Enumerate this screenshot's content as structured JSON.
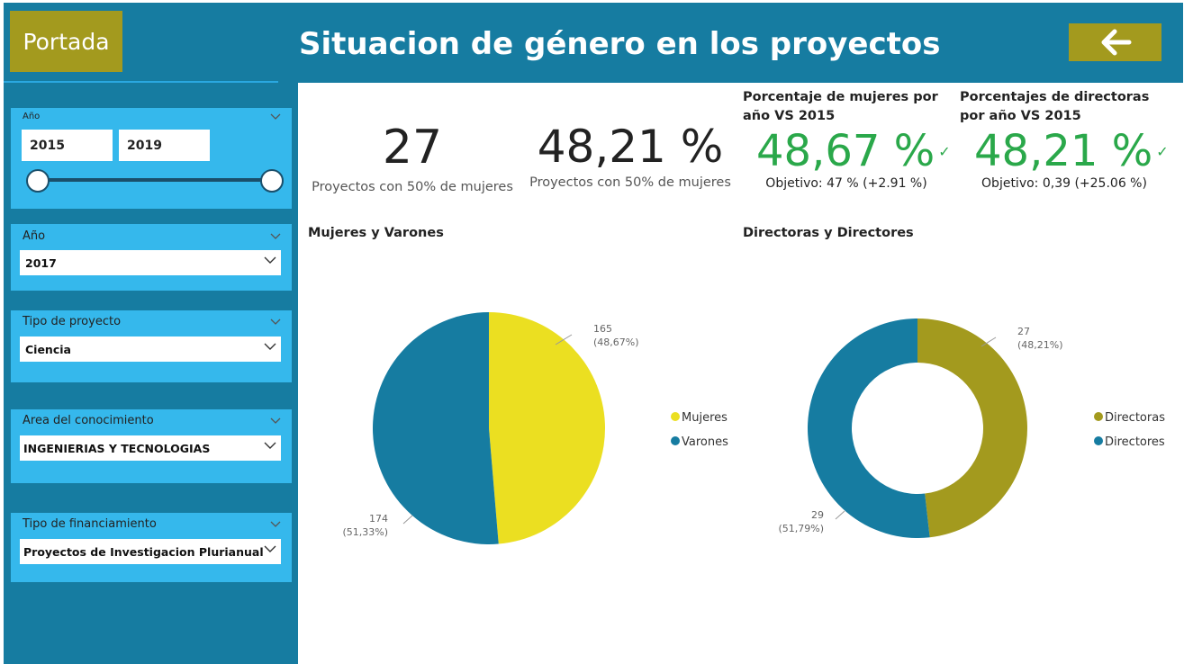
{
  "header": {
    "home_label": "Portada",
    "title": "Situacion de género en los proyectos",
    "back_icon": "arrow-left-icon"
  },
  "colors": {
    "teal": "#167ca1",
    "slicer_bg": "#35b8ec",
    "olive": "#a39a1e",
    "yellow": "#ebdf21",
    "green": "#2aa84a"
  },
  "filters": {
    "range": {
      "label": "Año",
      "start": "2015",
      "end": "2019"
    },
    "year": {
      "label": "Año",
      "value": "2017"
    },
    "project_type": {
      "label": "Tipo de proyecto",
      "value": "Ciencia"
    },
    "knowledge_area": {
      "label": "Area del conocimiento",
      "value": "INGENIERIAS Y TECNOLOGIAS"
    },
    "funding_type": {
      "label": "Tipo de financiamiento",
      "value": "Proyectos de Investigacion Plurianual"
    }
  },
  "kpis": [
    {
      "value": "27",
      "label": "Proyectos con 50% de mujeres"
    },
    {
      "value": "48,21 %",
      "label": "Proyectos con 50% de mujeres"
    }
  ],
  "cards": [
    {
      "title": "Porcentaje de mujeres por año VS 2015",
      "value": "48,67 %",
      "goal": "Objetivo: 47 % (+2.91 %)",
      "status_icon": "checkmark-icon"
    },
    {
      "title": "Porcentajes de directoras por año VS 2015",
      "value": "48,21 %",
      "goal": "Objetivo: 0,39 (+25.06 %)",
      "status_icon": "checkmark-icon"
    }
  ],
  "chart_data": [
    {
      "type": "pie",
      "title": "Mujeres y Varones",
      "categories": [
        "Mujeres",
        "Varones"
      ],
      "values": [
        165,
        174
      ],
      "data_labels": [
        "165",
        "174"
      ],
      "pct_labels": [
        "(48,67%)",
        "(51,33%)"
      ],
      "colors": [
        "#ebdf21",
        "#167ca1"
      ],
      "legend": "right"
    },
    {
      "type": "pie",
      "variant": "donut",
      "title": "Directoras y Directores",
      "categories": [
        "Directoras",
        "Directores"
      ],
      "values": [
        27,
        29
      ],
      "data_labels": [
        "27",
        "29"
      ],
      "pct_labels": [
        "(48,21%)",
        "(51,79%)"
      ],
      "colors": [
        "#a39a1e",
        "#167ca1"
      ],
      "legend": "right"
    }
  ]
}
